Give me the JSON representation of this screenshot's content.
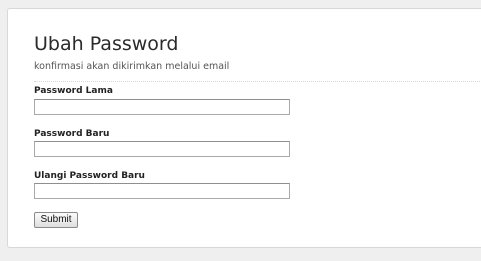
{
  "form": {
    "title": "Ubah Password",
    "subtitle": "konfirmasi akan dikirimkan melalui email",
    "fields": [
      {
        "label": "Password Lama",
        "value": ""
      },
      {
        "label": "Password Baru",
        "value": ""
      },
      {
        "label": "Ulangi Password Baru",
        "value": ""
      }
    ],
    "submit_label": "Submit"
  }
}
